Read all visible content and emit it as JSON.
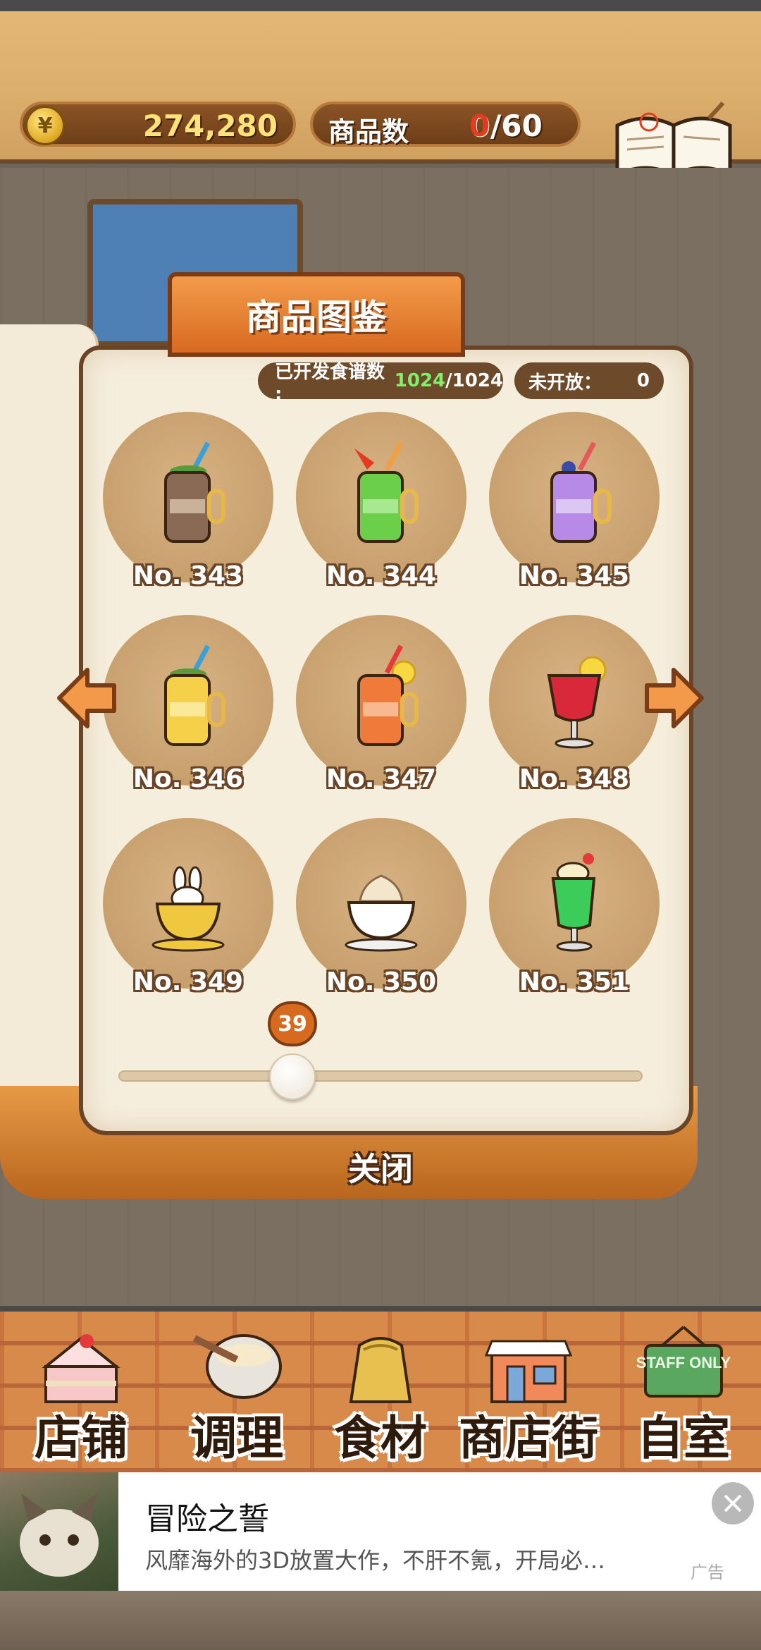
{
  "hud": {
    "currency_symbol": "¥",
    "money": "274,280",
    "items_label": "商品数",
    "items_current": "0",
    "items_max": "/60",
    "recipe_label": "食谱"
  },
  "catalog": {
    "title": "商品图鉴",
    "developed_label": "已开发食谱数 :",
    "developed_value": "1024",
    "developed_total": "/1024",
    "closed_label": "未开放：",
    "closed_value": "0",
    "items": [
      {
        "no": "No. 343",
        "icon": "brown-soda-jar"
      },
      {
        "no": "No. 344",
        "icon": "green-soda-jar"
      },
      {
        "no": "No. 345",
        "icon": "purple-soda-jar"
      },
      {
        "no": "No. 346",
        "icon": "yellow-soda-jar"
      },
      {
        "no": "No. 347",
        "icon": "orange-soda-jar"
      },
      {
        "no": "No. 348",
        "icon": "red-cocktail-glass"
      },
      {
        "no": "No. 349",
        "icon": "bunny-latte-cup"
      },
      {
        "no": "No. 350",
        "icon": "whipped-cream-coffee-cup"
      },
      {
        "no": "No. 351",
        "icon": "melon-cream-soda-glass"
      }
    ],
    "slider_value": "39",
    "slider_fraction": 0.28,
    "close_label": "关闭"
  },
  "nav": {
    "items": [
      {
        "label": "店铺",
        "icon": "cake-icon"
      },
      {
        "label": "调理",
        "icon": "mixing-bowl-icon"
      },
      {
        "label": "食材",
        "icon": "ingredients-sack-icon"
      },
      {
        "label": "商店街",
        "icon": "shop-street-icon"
      },
      {
        "label": "自室",
        "icon": "staff-only-sign-icon"
      }
    ],
    "staff_sign_text": "STAFF ONLY"
  },
  "ad": {
    "title": "冒险之誓",
    "description": "风靡海外的3D放置大作，不肝不氪，开局必…",
    "tag": "广告"
  },
  "colors": {
    "accent_orange": "#d86a20",
    "brown_dark": "#6a4426",
    "money_yellow": "#ffe27a",
    "count_red": "#e43a1e",
    "stat_green": "#7ef06a"
  }
}
